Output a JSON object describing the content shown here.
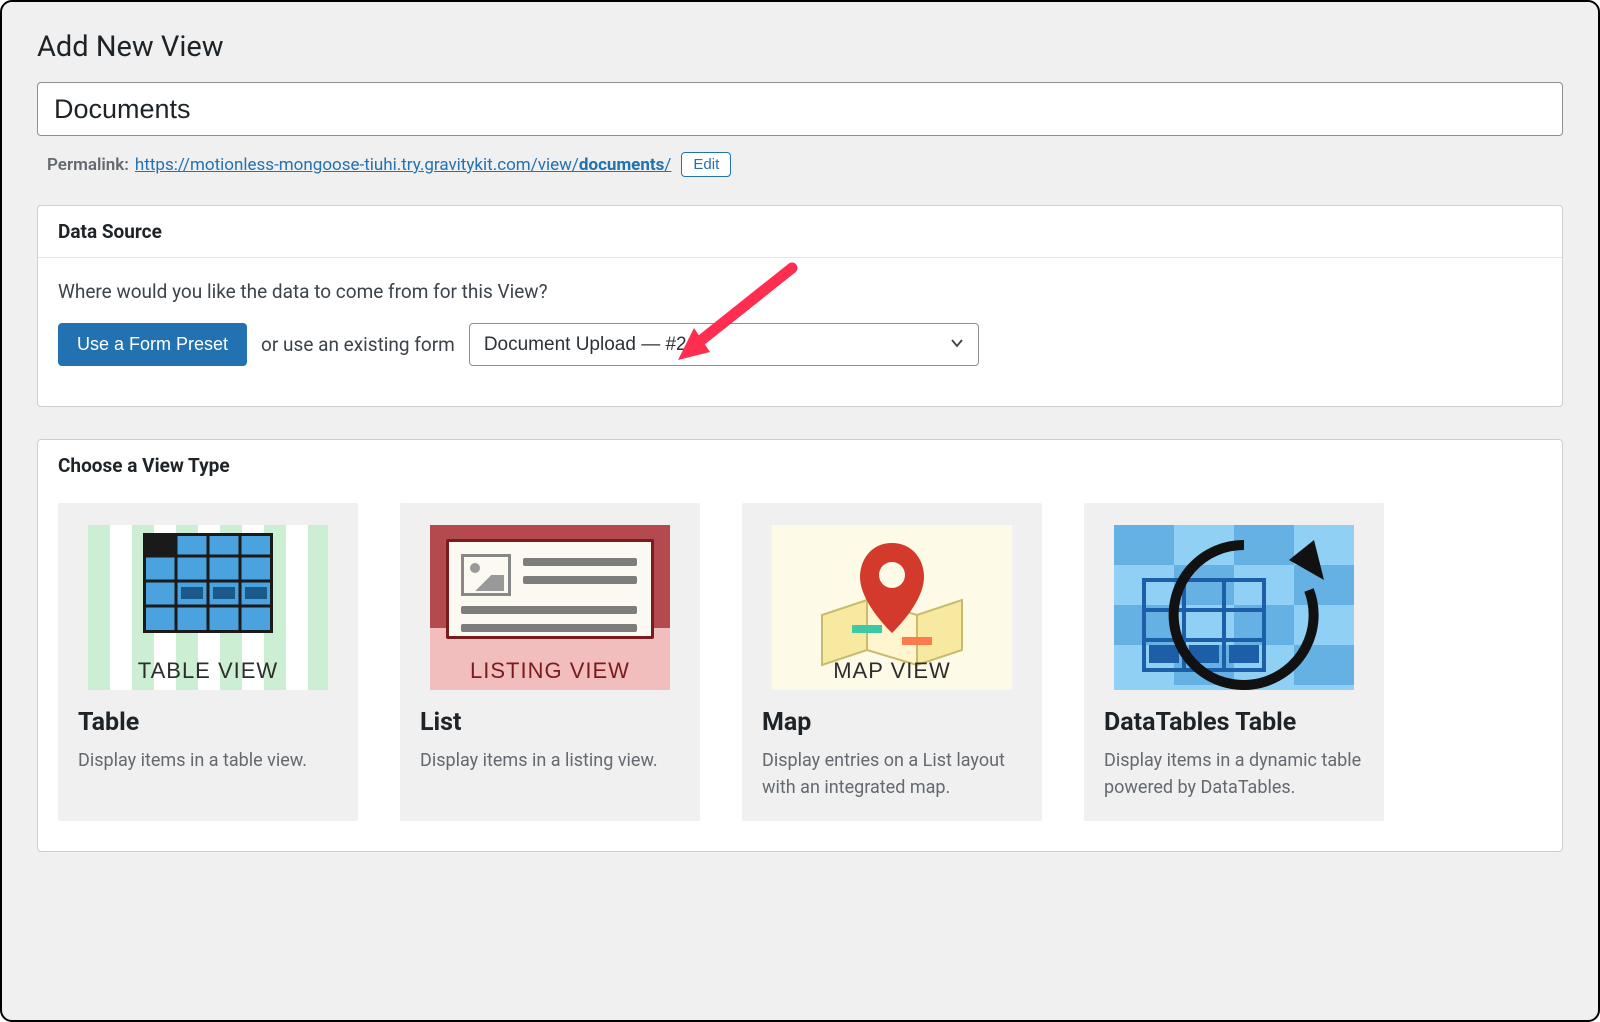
{
  "page": {
    "heading": "Add New View",
    "title_value": "Documents"
  },
  "permalink": {
    "label": "Permalink:",
    "url_base": "https://motionless-mongoose-tiuhi.try.gravitykit.com/view/",
    "slug": "documents",
    "trail": "/",
    "edit_label": "Edit"
  },
  "data_source": {
    "panel_title": "Data Source",
    "prompt": "Where would you like the data to come from for this View?",
    "preset_button": "Use a Form Preset",
    "or_text": "or use an existing form",
    "selected_form": "Document Upload — #21"
  },
  "view_type": {
    "panel_title": "Choose a View Type",
    "cards": [
      {
        "thumb_caption": "TABLE VIEW",
        "title": "Table",
        "description": "Display items in a table view."
      },
      {
        "thumb_caption": "LISTING VIEW",
        "title": "List",
        "description": "Display items in a listing view."
      },
      {
        "thumb_caption": "MAP VIEW",
        "title": "Map",
        "description": "Display entries on a List layout with an integrated map."
      },
      {
        "thumb_caption": "",
        "title": "DataTables Table",
        "description": "Display items in a dynamic table powered by DataTables."
      }
    ]
  }
}
